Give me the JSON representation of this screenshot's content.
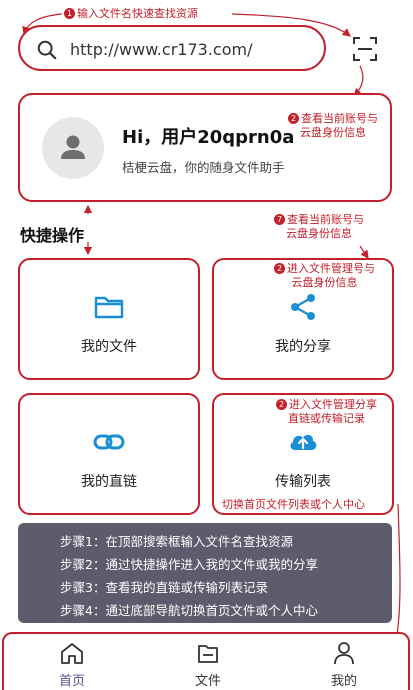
{
  "annotations": {
    "a1": {
      "num": "1",
      "text": "输入文件名快速查找资源"
    },
    "a2": {
      "num": "2",
      "line1": "查看当前账号与",
      "line2": "云盘身份信息"
    },
    "a3": {
      "num": "7",
      "line1": "查看当前账号与",
      "line2": "云盘身份信息"
    },
    "a4": {
      "num": "2",
      "line1": "进入文件管理号与",
      "line2": "云盘身份信息"
    },
    "a5": {
      "num": "2",
      "line1": "进入文件管理分享",
      "line2": "直链或传输记录"
    },
    "a6": {
      "text": "切换首页文件列表或个人中心"
    }
  },
  "search": {
    "value": "http://www.cr173.com/",
    "icon": "search-icon"
  },
  "scan": {
    "icon": "scan-icon"
  },
  "user": {
    "greeting": "Hi，用户20qprn0a",
    "subtitle": "桔梗云盘，你的随身文件助手"
  },
  "quick": {
    "title": "快捷操作",
    "tiles": [
      {
        "label": "我的文件",
        "icon": "folder-icon"
      },
      {
        "label": "我的分享",
        "icon": "share-icon"
      },
      {
        "label": "我的直链",
        "icon": "link-icon"
      },
      {
        "label": "传输列表",
        "icon": "cloud-upload-icon"
      }
    ]
  },
  "steps": [
    "步骤1：在顶部搜索框输入文件名查找资源",
    "步骤2：通过快捷操作进入我的文件或我的分享",
    "步骤3：查看我的直链或传输列表记录",
    "步骤4：通过底部导航切换首页文件或个人中心"
  ],
  "tabs": [
    {
      "label": "首页",
      "icon": "home-icon",
      "active": true
    },
    {
      "label": "文件",
      "icon": "file-icon",
      "active": false
    },
    {
      "label": "我的",
      "icon": "person-icon",
      "active": false
    }
  ],
  "colors": {
    "accent": "#c2202b",
    "primary_icon": "#1a8fd6",
    "steps_bg": "#5d5c6c",
    "active_tab": "#5a4f96"
  }
}
